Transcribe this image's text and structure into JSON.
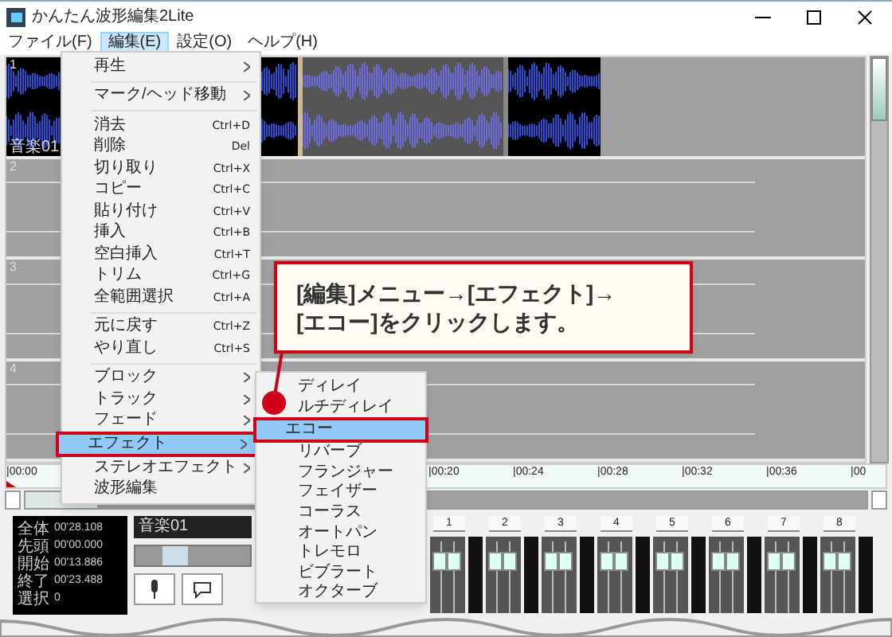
{
  "window": {
    "title": "かんたん波形編集2Lite"
  },
  "menubar": [
    {
      "label": "ファイル(F)",
      "selected": false
    },
    {
      "label": "編集(E)",
      "selected": true
    },
    {
      "label": "設定(O)",
      "selected": false
    },
    {
      "label": "ヘルプ(H)",
      "selected": false
    }
  ],
  "tracks": [
    {
      "number": "1",
      "name": "音楽01",
      "kind": "audio"
    },
    {
      "number": "2",
      "kind": "empty"
    },
    {
      "number": "3",
      "kind": "empty"
    },
    {
      "number": "4",
      "kind": "empty"
    }
  ],
  "timeline": [
    "|00:00",
    "|00:20",
    "|00:24",
    "|00:28",
    "|00:32",
    "|00:36",
    "|00"
  ],
  "edit_menu": [
    {
      "kind": "item",
      "label": "再生",
      "submenu": true,
      "selected": false
    },
    {
      "kind": "separator"
    },
    {
      "kind": "item",
      "label": "マーク/ヘッド移動",
      "submenu": true,
      "selected": false
    },
    {
      "kind": "separator"
    },
    {
      "kind": "item",
      "label": "消去",
      "shortcut": "Ctrl+D",
      "selected": false
    },
    {
      "kind": "item",
      "label": "削除",
      "shortcut": "Del",
      "selected": false
    },
    {
      "kind": "item",
      "label": "切り取り",
      "shortcut": "Ctrl+X",
      "selected": false
    },
    {
      "kind": "item",
      "label": "コピー",
      "shortcut": "Ctrl+C",
      "selected": false
    },
    {
      "kind": "item",
      "label": "貼り付け",
      "shortcut": "Ctrl+V",
      "selected": false
    },
    {
      "kind": "item",
      "label": "挿入",
      "shortcut": "Ctrl+B",
      "selected": false
    },
    {
      "kind": "item",
      "label": "空白挿入",
      "shortcut": "Ctrl+T",
      "selected": false
    },
    {
      "kind": "item",
      "label": "トリム",
      "shortcut": "Ctrl+G",
      "selected": false
    },
    {
      "kind": "item",
      "label": "全範囲選択",
      "shortcut": "Ctrl+A",
      "selected": false
    },
    {
      "kind": "separator"
    },
    {
      "kind": "item",
      "label": "元に戻す",
      "shortcut": "Ctrl+Z",
      "selected": false
    },
    {
      "kind": "item",
      "label": "やり直し",
      "shortcut": "Ctrl+S",
      "selected": false
    },
    {
      "kind": "separator"
    },
    {
      "kind": "item",
      "label": "ブロック",
      "submenu": true,
      "selected": false
    },
    {
      "kind": "item",
      "label": "トラック",
      "submenu": true,
      "selected": false
    },
    {
      "kind": "item",
      "label": "フェード",
      "submenu": true,
      "selected": false
    },
    {
      "kind": "item",
      "label": "エフェクト",
      "submenu": true,
      "selected": true
    },
    {
      "kind": "item",
      "label": "ステレオエフェクト",
      "submenu": true,
      "selected": false
    },
    {
      "kind": "item",
      "label": "波形編集",
      "selected": false
    }
  ],
  "effect_submenu": [
    {
      "label": "ディレイ",
      "selected": false
    },
    {
      "label": "ルチディレイ",
      "selected": false
    },
    {
      "label": "エコー",
      "selected": true
    },
    {
      "label": "リバーブ",
      "selected": false
    },
    {
      "label": "フランジャー",
      "selected": false
    },
    {
      "label": "フェイザー",
      "selected": false
    },
    {
      "label": "コーラス",
      "selected": false
    },
    {
      "label": "オートパン",
      "selected": false
    },
    {
      "label": "トレモロ",
      "selected": false
    },
    {
      "label": "ビブラート",
      "selected": false
    },
    {
      "label": "オクターブ",
      "selected": false
    }
  ],
  "callout": {
    "text": "[編集]メニュー→[エフェクト]→\n[エコー]をクリックします。"
  },
  "info_panel": [
    {
      "label": "全体",
      "value": "00'28.108"
    },
    {
      "label": "先頭",
      "value": "00'00.000"
    },
    {
      "label": "開始",
      "value": "00'13.886"
    },
    {
      "label": "終了",
      "value": "00'23.488"
    },
    {
      "label": "選択",
      "value": "0"
    }
  ],
  "track_panel": {
    "name": "音楽01",
    "level": 0.35
  },
  "mixer": [
    "1",
    "2",
    "3",
    "4",
    "5",
    "6",
    "7",
    "8"
  ]
}
